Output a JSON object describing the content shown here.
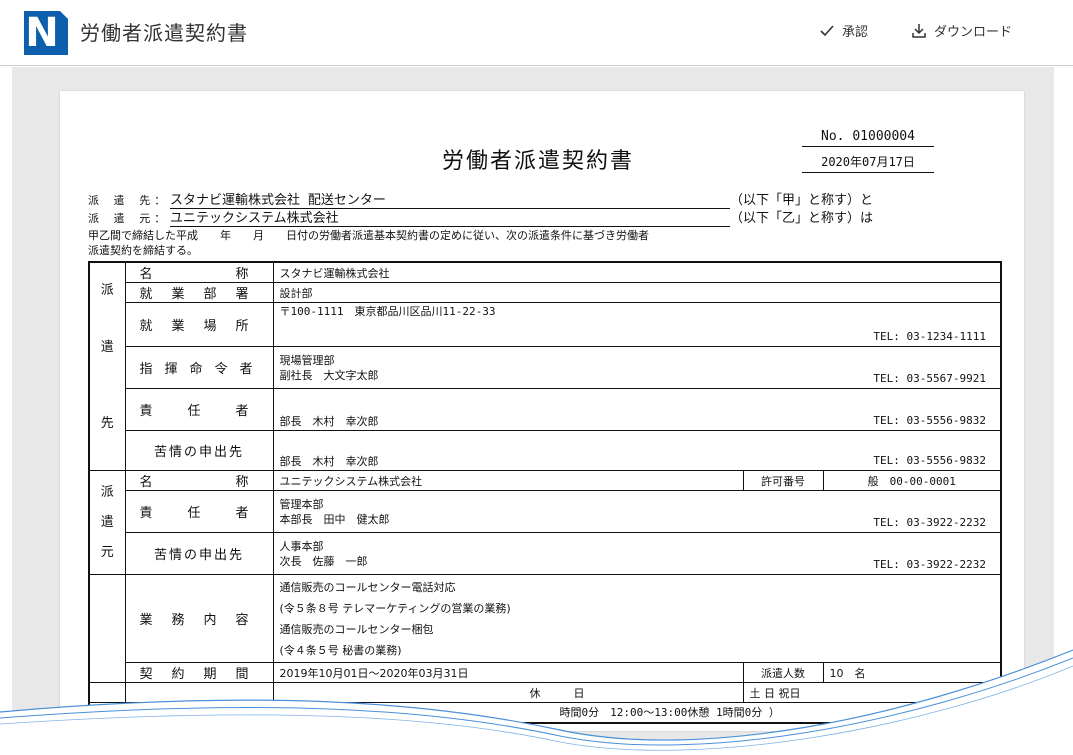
{
  "header": {
    "logo_letter": "N",
    "title": "労働者派遣契約書",
    "approve_label": "承認",
    "download_label": "ダウンロード"
  },
  "document": {
    "number": "No. 01000004",
    "date": "2020年07月17日",
    "title": "労働者派遣契約書",
    "dest_label": "派 遣 先：",
    "dest_value": "スタナビ運輸株式会社 配送センター",
    "dest_suffix": "（以下「甲」と称す）と",
    "src_label": "派 遣 元：",
    "src_value": "ユニテックシステム株式会社",
    "src_suffix": "（以下「乙」と称す）は",
    "intro_line1": "甲乙間で締結した平成　　年　　月　　日付の労働者派遣基本契約書の定めに従い、次の派遣条件に基づき労働者",
    "intro_line2": "派遣契約を締結する。"
  },
  "table": {
    "dest_group": [
      "派",
      "遣",
      "先"
    ],
    "src_group": [
      "派",
      "遣",
      "元"
    ],
    "rows": {
      "dest_name_label": "名称",
      "dest_name": "スタナビ運輸株式会社",
      "dept_label": "就業部署",
      "dept": "設計部",
      "place_label": "就業場所",
      "place": "〒100-1111　東京都品川区品川11-22-33",
      "place_tel": "TEL: 03-1234-1111",
      "cmd_label": "指揮命令者",
      "cmd_line1": "現場管理部",
      "cmd_line2": "副社長　大文字太郎",
      "cmd_tel": "TEL: 03-5567-9921",
      "resp_label": "責任者",
      "resp": "部長　木村　幸次郎",
      "resp_tel": "TEL: 03-5556-9832",
      "complaint_label": "苦情の申出先",
      "complaint": "部長　木村　幸次郎",
      "complaint_tel": "TEL: 03-5556-9832",
      "src_name_label": "名称",
      "src_name": "ユニテックシステム株式会社",
      "permit_label": "許可番号",
      "permit": "般　00-00-0001",
      "src_resp_label": "責任者",
      "src_resp_line1": "管理本部",
      "src_resp_line2": "本部長　田中　健太郎",
      "src_resp_tel": "TEL: 03-3922-2232",
      "src_complaint_label": "苦情の申出先",
      "src_complaint_line1": "人事本部",
      "src_complaint_line2": "次長　佐藤　一郎",
      "src_complaint_tel": "TEL: 03-3922-2232",
      "biz_label": "業務内容",
      "biz_lines": [
        "通信販売のコールセンター電話対応",
        "(令５条８号 テレマーケティングの営業の業務)",
        "通信販売のコールセンター梱包",
        "(令４条５号 秘書の業務)"
      ],
      "period_label": "契約期間",
      "period": "2019年10月01日～2020年03月31日",
      "headcount_label": "派遣人数",
      "headcount": "10　名",
      "holiday_label": "休　　　日",
      "holiday": "土 日 祝日",
      "break_text": "時間0分　12:00～13:00休憩 1時間0分 ）"
    }
  },
  "colors": {
    "brand": "#0b5fad",
    "viewer_bg": "#e8e8e8",
    "wave": "#4a90d9"
  },
  "icons": {
    "approve": "check-icon",
    "download": "download-icon"
  }
}
